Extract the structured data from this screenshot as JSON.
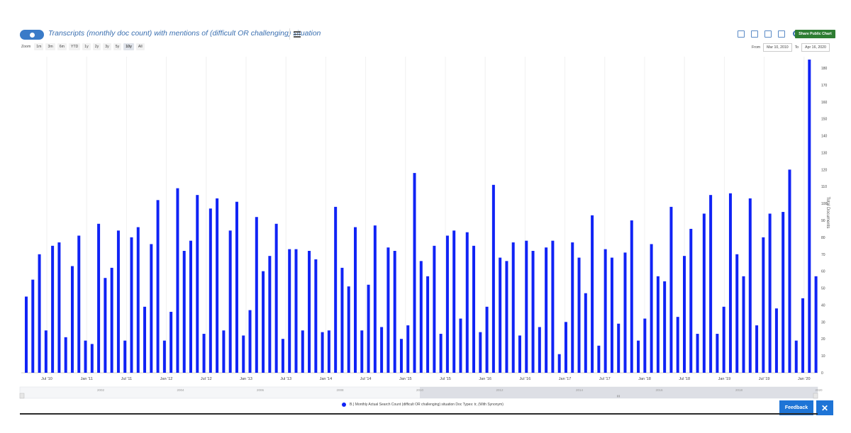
{
  "header": {
    "title": "Transcripts (monthly doc count) with mentions of (difficult OR challenging) situation",
    "share_label": "Share Public Chart"
  },
  "icons": [
    "toggle-icon",
    "menu-icon",
    "trash-icon",
    "save-icon",
    "folder-icon",
    "bar-chart-icon",
    "gear-icon",
    "close-icon"
  ],
  "zoom": {
    "label": "Zoom",
    "options": [
      "1m",
      "3m",
      "6m",
      "YTD",
      "1y",
      "2y",
      "3y",
      "5y",
      "10y",
      "All"
    ],
    "active": "10y"
  },
  "range": {
    "from_label": "From",
    "from_value": "Mar 10, 2010",
    "to_label": "To",
    "to_value": "Apr 16, 2020"
  },
  "navigator": {
    "year_labels": [
      "2002",
      "2004",
      "2006",
      "2008",
      "2010",
      "2012",
      "2014",
      "2016",
      "2018",
      "2020"
    ],
    "handle_label": "III"
  },
  "legend": {
    "label": "B.) Monthly Actual Search Count (difficult OR challenging) situation Doc Types: tr, (With Synonym)"
  },
  "buttons": {
    "feedback": "Feedback",
    "close": "✕"
  },
  "colors": {
    "bar": "#1023f5",
    "share": "#2e7d32",
    "feedback": "#1e74d6",
    "title": "#3a6fb0"
  },
  "chart_data": {
    "type": "bar",
    "ylabel": "Total Documents",
    "ylim": [
      0,
      180
    ],
    "yticks": [
      0,
      10,
      20,
      30,
      40,
      50,
      60,
      70,
      80,
      90,
      100,
      110,
      120,
      130,
      140,
      150,
      160,
      170,
      180
    ],
    "x_tick_labels": [
      "Jul '10",
      "Jan '11",
      "Jul '11",
      "Jan '12",
      "Jul '12",
      "Jan '13",
      "Jul '13",
      "Jan '14",
      "Jul '14",
      "Jan '15",
      "Jul '15",
      "Jan '16",
      "Jul '16",
      "Jan '17",
      "Jul '17",
      "Jan '18",
      "Jul '18",
      "Jan '19",
      "Jul '19",
      "Jan '20"
    ],
    "grid": true,
    "legend_position": "bottom-center",
    "x_start": "Mar 2010",
    "x_end": "Apr 2020",
    "series": [
      {
        "name": "B.) Monthly Actual Search Count (difficult OR challenging) situation Doc Types: tr, (With Synonym)",
        "values": [
          45,
          55,
          70,
          25,
          75,
          77,
          21,
          63,
          81,
          19,
          17,
          88,
          56,
          62,
          84,
          19,
          80,
          86,
          39,
          76,
          102,
          19,
          36,
          109,
          72,
          78,
          105,
          23,
          97,
          103,
          25,
          84,
          101,
          22,
          37,
          92,
          60,
          69,
          88,
          20,
          73,
          73,
          25,
          72,
          67,
          24,
          25,
          98,
          62,
          51,
          86,
          25,
          52,
          87,
          27,
          74,
          72,
          20,
          28,
          118,
          66,
          57,
          75,
          23,
          81,
          84,
          32,
          83,
          75,
          24,
          39,
          111,
          68,
          66,
          77,
          22,
          78,
          72,
          27,
          74,
          78,
          11,
          30,
          77,
          68,
          47,
          93,
          16,
          73,
          68,
          29,
          71,
          90,
          19,
          32,
          76,
          57,
          54,
          98,
          33,
          69,
          85,
          23,
          94,
          105,
          23,
          39,
          106,
          70,
          57,
          103,
          28,
          80,
          94,
          38,
          95,
          120,
          19,
          44,
          185,
          57
        ]
      }
    ]
  }
}
